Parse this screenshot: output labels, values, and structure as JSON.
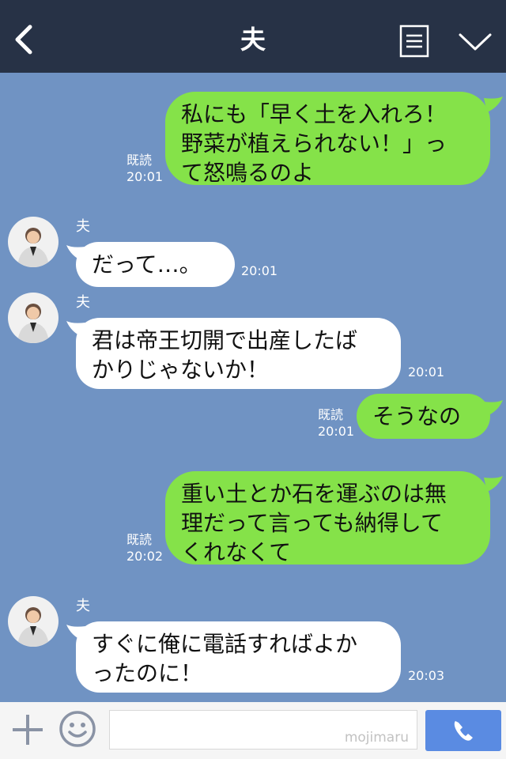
{
  "header": {
    "title": "夫",
    "icons": [
      "back-arrow-icon",
      "menu-icon",
      "chevron-down-icon"
    ]
  },
  "messages": [
    {
      "side": "right",
      "text": "私にも「早く土を入れろ！\n野菜が植えられない！」っ\nて怒鳴るのよ",
      "read": "既読",
      "time": "20:01"
    },
    {
      "side": "left",
      "sender": "夫",
      "text": "だって…。",
      "time": "20:01"
    },
    {
      "side": "left",
      "sender": "夫",
      "text": "君は帝王切開で出産したば\nかりじゃないか！",
      "time": "20:01"
    },
    {
      "side": "right",
      "text": "そうなの",
      "read": "既読",
      "time": "20:01"
    },
    {
      "side": "right",
      "text": "重い土とか石を運ぶのは無\n理だって言っても納得して\nくれなくて",
      "read": "既読",
      "time": "20:02"
    },
    {
      "side": "left",
      "sender": "夫",
      "text": "すぐに俺に電話すればよか\nったのに！",
      "time": "20:03"
    }
  ],
  "footer": {
    "watermark": "mojimaru",
    "icons": [
      "plus-icon",
      "emoji-icon",
      "phone-icon"
    ]
  },
  "colors": {
    "header_bg": "#273246",
    "chat_bg": "#7093c3",
    "sent_bubble": "#85e249",
    "received_bubble": "#ffffff",
    "call_button": "#5a8be2"
  }
}
